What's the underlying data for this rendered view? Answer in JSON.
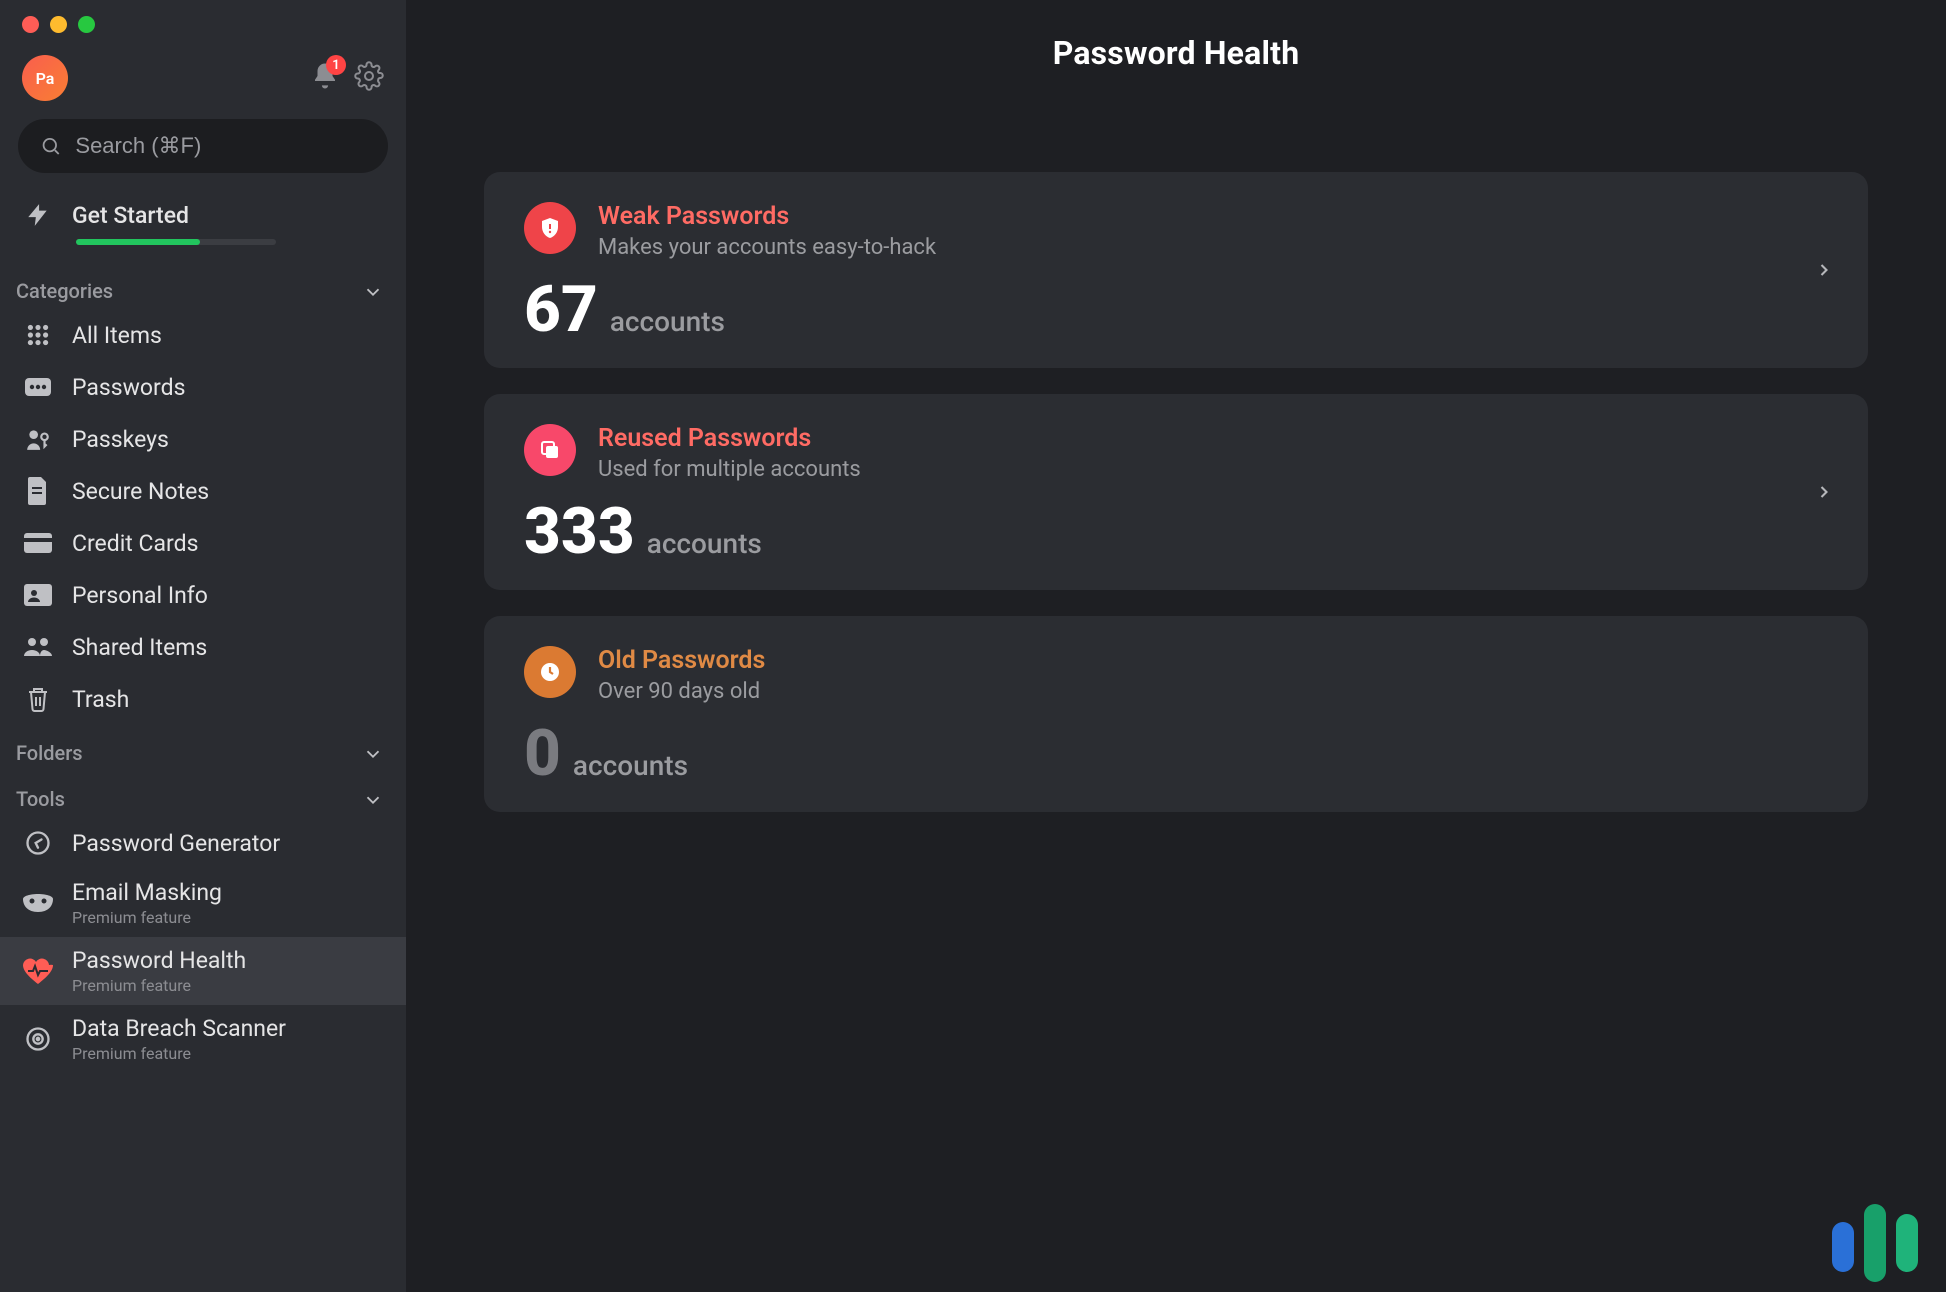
{
  "avatar": {
    "initials": "Pa"
  },
  "notifications": {
    "count": "1"
  },
  "search": {
    "placeholder": "Search (⌘F)"
  },
  "get_started": {
    "label": "Get Started",
    "progress_pct": 62
  },
  "sections": {
    "categories": "Categories",
    "folders": "Folders",
    "tools": "Tools"
  },
  "categories": [
    {
      "id": "all",
      "label": "All Items"
    },
    {
      "id": "passwords",
      "label": "Passwords"
    },
    {
      "id": "passkeys",
      "label": "Passkeys"
    },
    {
      "id": "notes",
      "label": "Secure Notes"
    },
    {
      "id": "cards",
      "label": "Credit Cards"
    },
    {
      "id": "personal",
      "label": "Personal Info"
    },
    {
      "id": "shared",
      "label": "Shared Items"
    },
    {
      "id": "trash",
      "label": "Trash"
    }
  ],
  "tools": [
    {
      "id": "generator",
      "label": "Password Generator",
      "sub": ""
    },
    {
      "id": "masking",
      "label": "Email Masking",
      "sub": "Premium feature"
    },
    {
      "id": "health",
      "label": "Password Health",
      "sub": "Premium feature",
      "selected": true
    },
    {
      "id": "breach",
      "label": "Data Breach Scanner",
      "sub": "Premium feature"
    }
  ],
  "page": {
    "title": "Password Health"
  },
  "health_cards": {
    "weak": {
      "title": "Weak Passwords",
      "sub": "Makes your accounts easy-to-hack",
      "count": "67",
      "unit": "accounts"
    },
    "reused": {
      "title": "Reused Passwords",
      "sub": "Used for multiple accounts",
      "count": "333",
      "unit": "accounts"
    },
    "old": {
      "title": "Old Passwords",
      "sub": "Over 90 days old",
      "count": "0",
      "unit": "accounts"
    }
  },
  "colors": {
    "danger": "#ff6b64",
    "warn": "#e08a45",
    "accent": "#22c55e"
  }
}
